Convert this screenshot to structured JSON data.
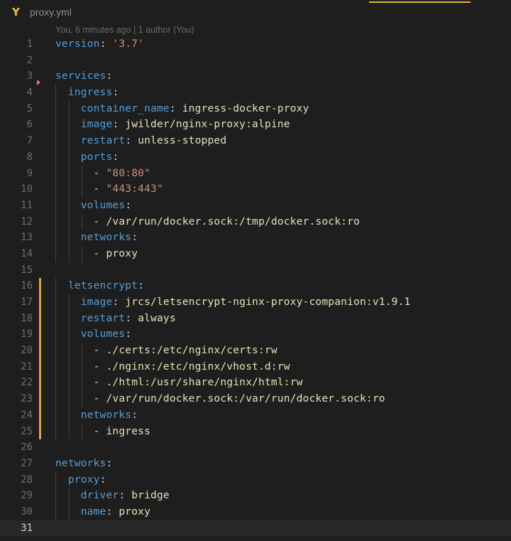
{
  "tab": {
    "icon": "yaml-icon",
    "icon_glyph": "Y",
    "title": "proxy.yml"
  },
  "blame": "You, 6 minutes ago | 1 author (You)",
  "colors": {
    "key": "#569cd6",
    "string": "#ce9178",
    "value": "#e8e0b8",
    "modified_marker": "#e0a050",
    "accent": "#e8b830"
  },
  "lines": [
    {
      "n": "1",
      "tokens": [
        [
          "k",
          "version"
        ],
        [
          "p",
          ": "
        ],
        [
          "s",
          "'3.7'"
        ]
      ]
    },
    {
      "n": "2",
      "tokens": []
    },
    {
      "n": "3",
      "tokens": [
        [
          "k",
          "services"
        ],
        [
          "p",
          ":"
        ]
      ]
    },
    {
      "n": "4",
      "tokens": [
        [
          "p",
          "  "
        ],
        [
          "k",
          "ingress"
        ],
        [
          "p",
          ":"
        ]
      ]
    },
    {
      "n": "5",
      "tokens": [
        [
          "p",
          "    "
        ],
        [
          "k",
          "container_name"
        ],
        [
          "p",
          ": "
        ],
        [
          "v",
          "ingress-docker-proxy"
        ]
      ]
    },
    {
      "n": "6",
      "tokens": [
        [
          "p",
          "    "
        ],
        [
          "k",
          "image"
        ],
        [
          "p",
          ": "
        ],
        [
          "v",
          "jwilder/nginx-proxy:alpine"
        ]
      ]
    },
    {
      "n": "7",
      "tokens": [
        [
          "p",
          "    "
        ],
        [
          "k",
          "restart"
        ],
        [
          "p",
          ": "
        ],
        [
          "v",
          "unless-stopped"
        ]
      ]
    },
    {
      "n": "8",
      "tokens": [
        [
          "p",
          "    "
        ],
        [
          "k",
          "ports"
        ],
        [
          "p",
          ":"
        ]
      ]
    },
    {
      "n": "9",
      "tokens": [
        [
          "p",
          "      "
        ],
        [
          "d",
          "- "
        ],
        [
          "s",
          "\"80:80\""
        ]
      ]
    },
    {
      "n": "10",
      "tokens": [
        [
          "p",
          "      "
        ],
        [
          "d",
          "- "
        ],
        [
          "s",
          "\"443:443\""
        ]
      ]
    },
    {
      "n": "11",
      "tokens": [
        [
          "p",
          "    "
        ],
        [
          "k",
          "volumes"
        ],
        [
          "p",
          ":"
        ]
      ]
    },
    {
      "n": "12",
      "tokens": [
        [
          "p",
          "      "
        ],
        [
          "d",
          "- "
        ],
        [
          "v",
          "/var/run/docker.sock:/tmp/docker.sock:ro"
        ]
      ]
    },
    {
      "n": "13",
      "tokens": [
        [
          "p",
          "    "
        ],
        [
          "k",
          "networks"
        ],
        [
          "p",
          ":"
        ]
      ]
    },
    {
      "n": "14",
      "tokens": [
        [
          "p",
          "      "
        ],
        [
          "d",
          "- "
        ],
        [
          "v",
          "proxy"
        ]
      ]
    },
    {
      "n": "15",
      "tokens": []
    },
    {
      "n": "16",
      "tokens": [
        [
          "p",
          "  "
        ],
        [
          "k",
          "letsencrypt"
        ],
        [
          "p",
          ":"
        ]
      ]
    },
    {
      "n": "17",
      "tokens": [
        [
          "p",
          "    "
        ],
        [
          "k",
          "image"
        ],
        [
          "p",
          ": "
        ],
        [
          "v",
          "jrcs/letsencrypt-nginx-proxy-companion:v1.9.1"
        ]
      ]
    },
    {
      "n": "18",
      "tokens": [
        [
          "p",
          "    "
        ],
        [
          "k",
          "restart"
        ],
        [
          "p",
          ": "
        ],
        [
          "v",
          "always"
        ]
      ]
    },
    {
      "n": "19",
      "tokens": [
        [
          "p",
          "    "
        ],
        [
          "k",
          "volumes"
        ],
        [
          "p",
          ":"
        ]
      ]
    },
    {
      "n": "20",
      "tokens": [
        [
          "p",
          "      "
        ],
        [
          "d",
          "- "
        ],
        [
          "v",
          "./certs:/etc/nginx/certs:rw"
        ]
      ]
    },
    {
      "n": "21",
      "tokens": [
        [
          "p",
          "      "
        ],
        [
          "d",
          "- "
        ],
        [
          "v",
          "./nginx:/etc/nginx/vhost.d:rw"
        ]
      ]
    },
    {
      "n": "22",
      "tokens": [
        [
          "p",
          "      "
        ],
        [
          "d",
          "- "
        ],
        [
          "v",
          "./html:/usr/share/nginx/html:rw"
        ]
      ]
    },
    {
      "n": "23",
      "tokens": [
        [
          "p",
          "      "
        ],
        [
          "d",
          "- "
        ],
        [
          "v",
          "/var/run/docker.sock:/var/run/docker.sock:ro"
        ]
      ]
    },
    {
      "n": "24",
      "tokens": [
        [
          "p",
          "    "
        ],
        [
          "k",
          "networks"
        ],
        [
          "p",
          ":"
        ]
      ]
    },
    {
      "n": "25",
      "tokens": [
        [
          "p",
          "      "
        ],
        [
          "d",
          "- "
        ],
        [
          "v",
          "ingress"
        ]
      ]
    },
    {
      "n": "26",
      "tokens": []
    },
    {
      "n": "27",
      "tokens": [
        [
          "k",
          "networks"
        ],
        [
          "p",
          ":"
        ]
      ]
    },
    {
      "n": "28",
      "tokens": [
        [
          "p",
          "  "
        ],
        [
          "k",
          "proxy"
        ],
        [
          "p",
          ":"
        ]
      ]
    },
    {
      "n": "29",
      "tokens": [
        [
          "p",
          "    "
        ],
        [
          "k",
          "driver"
        ],
        [
          "p",
          ": "
        ],
        [
          "v",
          "bridge"
        ]
      ]
    },
    {
      "n": "30",
      "tokens": [
        [
          "p",
          "    "
        ],
        [
          "k",
          "name"
        ],
        [
          "p",
          ": "
        ],
        [
          "v",
          "proxy"
        ]
      ]
    },
    {
      "n": "31",
      "tokens": []
    }
  ],
  "current_line": "31",
  "modified_lines": [
    "16",
    "17",
    "18",
    "19",
    "20",
    "21",
    "22",
    "23",
    "24",
    "25"
  ]
}
